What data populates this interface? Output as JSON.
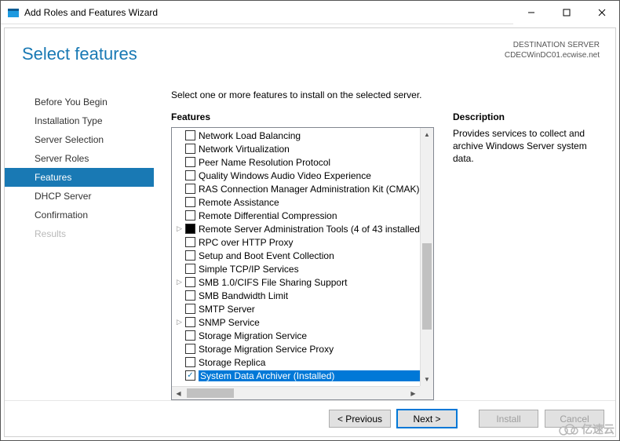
{
  "title": "Add Roles and Features Wizard",
  "heading": "Select features",
  "destination": {
    "label": "DESTINATION SERVER",
    "server": "CDECWinDC01.ecwise.net"
  },
  "sidebar": {
    "items": [
      {
        "label": "Before You Begin"
      },
      {
        "label": "Installation Type"
      },
      {
        "label": "Server Selection"
      },
      {
        "label": "Server Roles"
      },
      {
        "label": "Features"
      },
      {
        "label": "DHCP Server"
      },
      {
        "label": "Confirmation"
      },
      {
        "label": "Results"
      }
    ],
    "selected": 4,
    "disabled": [
      7
    ]
  },
  "instruction": "Select one or more features to install on the selected server.",
  "features_heading": "Features",
  "features": [
    {
      "label": "Network Load Balancing"
    },
    {
      "label": "Network Virtualization"
    },
    {
      "label": "Peer Name Resolution Protocol"
    },
    {
      "label": "Quality Windows Audio Video Experience"
    },
    {
      "label": "RAS Connection Manager Administration Kit (CMAK)"
    },
    {
      "label": "Remote Assistance"
    },
    {
      "label": "Remote Differential Compression"
    },
    {
      "label": "Remote Server Administration Tools (4 of 43 installed)",
      "expandable": true,
      "filled": true
    },
    {
      "label": "RPC over HTTP Proxy"
    },
    {
      "label": "Setup and Boot Event Collection"
    },
    {
      "label": "Simple TCP/IP Services"
    },
    {
      "label": "SMB 1.0/CIFS File Sharing Support",
      "expandable": true
    },
    {
      "label": "SMB Bandwidth Limit"
    },
    {
      "label": "SMTP Server"
    },
    {
      "label": "SNMP Service",
      "expandable": true
    },
    {
      "label": "Storage Migration Service"
    },
    {
      "label": "Storage Migration Service Proxy"
    },
    {
      "label": "Storage Replica"
    },
    {
      "label": "System Data Archiver (Installed)",
      "checked": true,
      "selected": true
    }
  ],
  "description": {
    "heading": "Description",
    "text": "Provides services to collect and archive Windows Server system data."
  },
  "buttons": {
    "previous": "< Previous",
    "next": "Next >",
    "install": "Install",
    "cancel": "Cancel"
  },
  "watermark": "亿速云"
}
